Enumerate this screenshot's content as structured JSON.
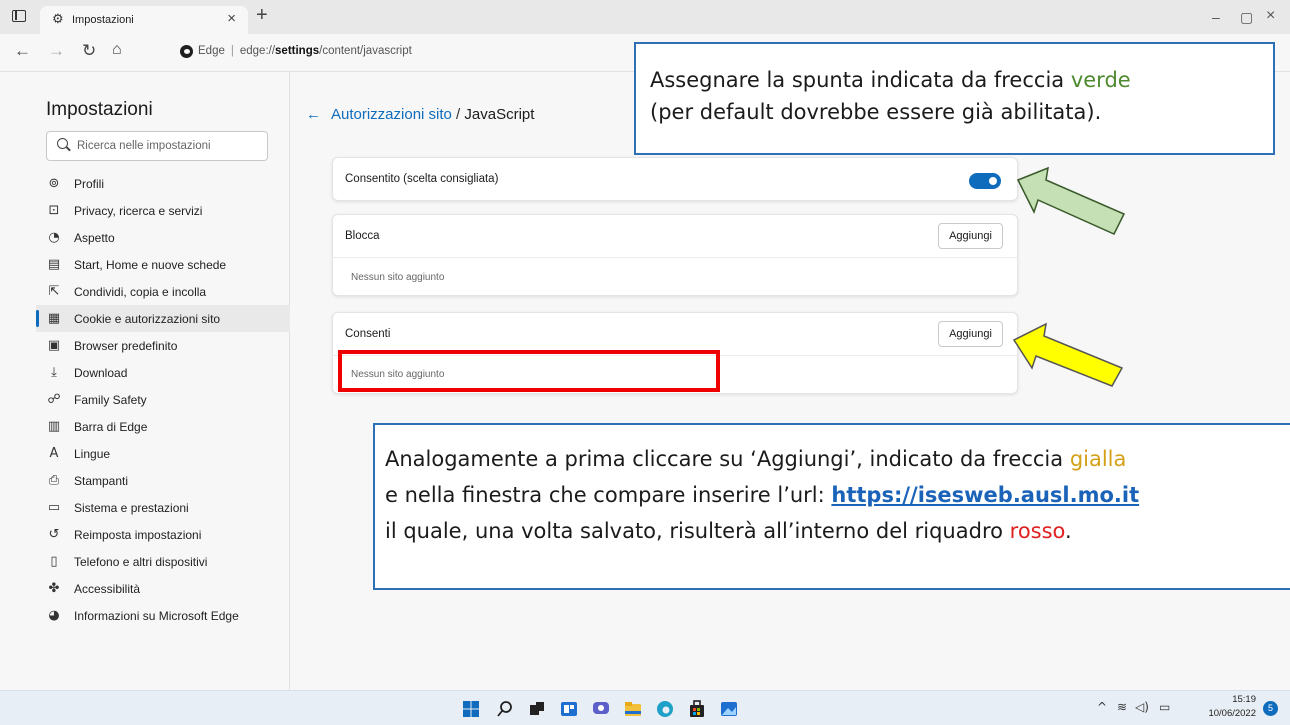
{
  "window": {
    "tab_title": "Impostazioni",
    "tab_close": "×",
    "new_tab": "+",
    "minimize": "–",
    "maximize": "▢",
    "close": "×"
  },
  "addressbar": {
    "prefix": "Edge",
    "separator": "|",
    "url_host": "edge://settings",
    "url_path": "/content/javascript"
  },
  "sidebar": {
    "title": "Impostazioni",
    "search_placeholder": "Ricerca nelle impostazioni",
    "items": [
      {
        "label": "Profili",
        "icon": "profile-icon",
        "glyph": "⊚"
      },
      {
        "label": "Privacy, ricerca e servizi",
        "icon": "lock-icon",
        "glyph": "⊡"
      },
      {
        "label": "Aspetto",
        "icon": "appearance-icon",
        "glyph": "◔"
      },
      {
        "label": "Start, Home e nuove schede",
        "icon": "home-tabs-icon",
        "glyph": "▤"
      },
      {
        "label": "Condividi, copia e incolla",
        "icon": "share-icon",
        "glyph": "⇱"
      },
      {
        "label": "Cookie e autorizzazioni sito",
        "icon": "cookie-icon",
        "glyph": "▦"
      },
      {
        "label": "Browser predefinito",
        "icon": "default-browser-icon",
        "glyph": "▣"
      },
      {
        "label": "Download",
        "icon": "download-icon",
        "glyph": "⤓"
      },
      {
        "label": "Family Safety",
        "icon": "family-icon",
        "glyph": "☍"
      },
      {
        "label": "Barra di Edge",
        "icon": "edge-bar-icon",
        "glyph": "▥"
      },
      {
        "label": "Lingue",
        "icon": "language-icon",
        "glyph": "A"
      },
      {
        "label": "Stampanti",
        "icon": "printer-icon",
        "glyph": "⎙"
      },
      {
        "label": "Sistema e prestazioni",
        "icon": "system-icon",
        "glyph": "▭"
      },
      {
        "label": "Reimposta impostazioni",
        "icon": "reset-icon",
        "glyph": "↺"
      },
      {
        "label": "Telefono e altri dispositivi",
        "icon": "phone-icon",
        "glyph": "▯"
      },
      {
        "label": "Accessibilità",
        "icon": "accessibility-icon",
        "glyph": "✤"
      },
      {
        "label": "Informazioni su Microsoft Edge",
        "icon": "edge-logo-icon",
        "glyph": "◕"
      }
    ],
    "active_index": 5
  },
  "main": {
    "breadcrumb_back": "←",
    "breadcrumb_link": "Autorizzazioni sito",
    "breadcrumb_sep": " / ",
    "breadcrumb_current": "JavaScript",
    "allowed_label": "Consentito (scelta consigliata)",
    "allowed_toggle": "on",
    "block_title": "Blocca",
    "block_add": "Aggiungi",
    "block_empty": "Nessun sito aggiunto",
    "allow_title": "Consenti",
    "allow_add": "Aggiungi",
    "allow_empty": "Nessun sito aggiunto"
  },
  "annotations": {
    "callout1_line1a": "Assegnare la spunta indicata da freccia ",
    "callout1_green": "verde",
    "callout1_line2": "(per default dovrebbe essere già abilitata).",
    "callout2_line1a": "Analogamente a prima cliccare su ‘Aggiungi’, indicato da freccia ",
    "callout2_yellow": "gialla",
    "callout2_line2a": "e nella finestra che compare inserire l’url: ",
    "callout2_url": "https://isesweb.ausl.mo.it",
    "callout2_line3a": "il quale, una volta salvato, risulterà all’interno del riquadro ",
    "callout2_red": "rosso",
    "callout2_line3b": ".",
    "colors": {
      "green_arrow": "#c5e0b4",
      "yellow_arrow": "#ffff00",
      "red_box": "#ee0000",
      "callout_border": "#2e6fb6"
    }
  },
  "taskbar": {
    "icons": [
      "windows-start-icon",
      "search-icon",
      "task-view-icon",
      "widgets-icon",
      "chat-icon",
      "file-explorer-icon",
      "edge-icon",
      "store-icon",
      "photos-icon"
    ],
    "time": "15:19",
    "date": "10/06/2022",
    "notifications": "5",
    "tray_chevron": "^"
  }
}
